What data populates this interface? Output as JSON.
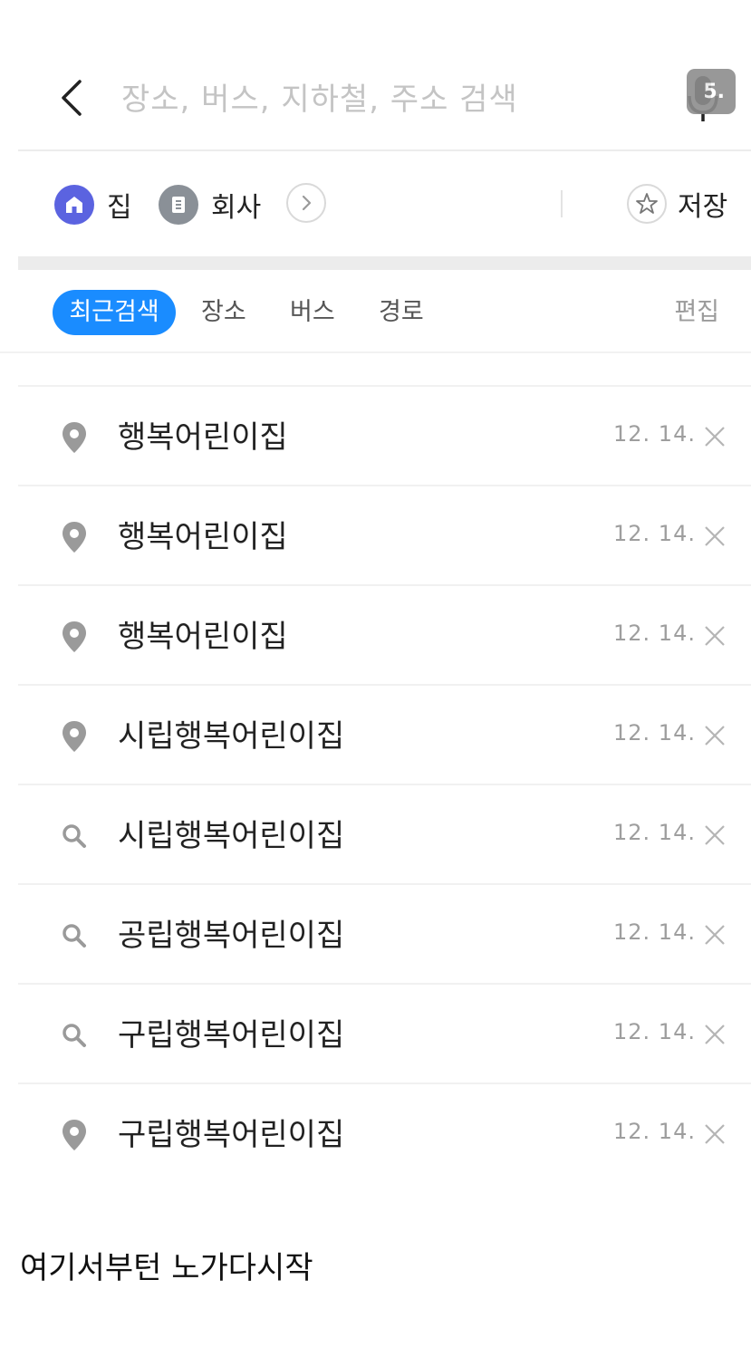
{
  "search": {
    "placeholder": "장소, 버스, 지하철, 주소 검색",
    "mic_badge": "5."
  },
  "shortcuts": {
    "home_label": "집",
    "work_label": "회사",
    "save_label": "저장"
  },
  "tabs": {
    "items": [
      {
        "label": "최근검색",
        "active": true
      },
      {
        "label": "장소",
        "active": false
      },
      {
        "label": "버스",
        "active": false
      },
      {
        "label": "경로",
        "active": false
      }
    ],
    "edit_label": "편집"
  },
  "recent": [
    {
      "type": "place",
      "icon": "location-pin-icon",
      "name": "행복어린이집",
      "date": "12. 14."
    },
    {
      "type": "place",
      "icon": "location-pin-icon",
      "name": "행복어린이집",
      "date": "12. 14."
    },
    {
      "type": "place",
      "icon": "location-pin-icon",
      "name": "행복어린이집",
      "date": "12. 14."
    },
    {
      "type": "place",
      "icon": "location-pin-icon",
      "name": "시립행복어린이집",
      "date": "12. 14."
    },
    {
      "type": "search",
      "icon": "magnifier-icon",
      "name": "시립행복어린이집",
      "date": "12. 14."
    },
    {
      "type": "search",
      "icon": "magnifier-icon",
      "name": "공립행복어린이집",
      "date": "12. 14."
    },
    {
      "type": "search",
      "icon": "magnifier-icon",
      "name": "구립행복어린이집",
      "date": "12. 14."
    },
    {
      "type": "place",
      "icon": "location-pin-icon",
      "name": "구립행복어린이집",
      "date": "12. 14."
    }
  ],
  "caption": "여기서부턴 노가다시작",
  "colors": {
    "accent": "#1a8cff",
    "home": "#5b63e0",
    "work": "#8a9097",
    "icon_gray": "#9a9a9a"
  }
}
